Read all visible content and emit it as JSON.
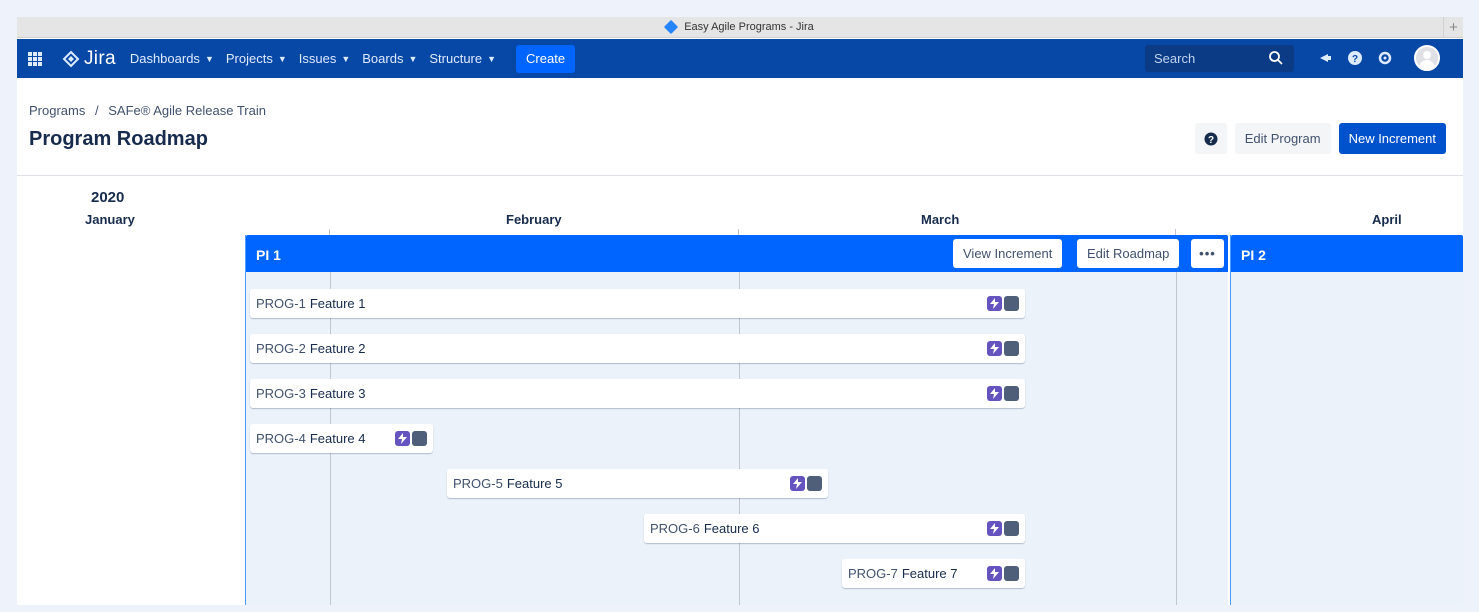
{
  "window": {
    "title": "Easy Agile Programs - Jira"
  },
  "nav": {
    "logo_text": "Jira",
    "menu": [
      {
        "label": "Dashboards"
      },
      {
        "label": "Projects"
      },
      {
        "label": "Issues"
      },
      {
        "label": "Boards"
      },
      {
        "label": "Structure"
      }
    ],
    "create_label": "Create",
    "search_placeholder": "Search",
    "icons": [
      "app-switcher-icon",
      "notifications-icon",
      "help-icon",
      "settings-icon",
      "avatar"
    ]
  },
  "breadcrumb": {
    "root": "Programs",
    "separator": "/",
    "current": "SAFe® Agile Release Train"
  },
  "page": {
    "title": "Program Roadmap",
    "actions": {
      "edit_program": "Edit Program",
      "new_increment": "New Increment"
    }
  },
  "timeline": {
    "year": "2020",
    "months": [
      "January",
      "February",
      "March",
      "April"
    ]
  },
  "increments": [
    {
      "label": "PI 1",
      "view_label": "View Increment",
      "edit_label": "Edit Roadmap",
      "more_label": "•••"
    },
    {
      "label": "PI 2"
    }
  ],
  "features": [
    {
      "key": "PROG-1",
      "name": "Feature 1"
    },
    {
      "key": "PROG-2",
      "name": "Feature 2"
    },
    {
      "key": "PROG-3",
      "name": "Feature 3"
    },
    {
      "key": "PROG-4",
      "name": "Feature 4"
    },
    {
      "key": "PROG-5",
      "name": "Feature 5"
    },
    {
      "key": "PROG-6",
      "name": "Feature 6"
    },
    {
      "key": "PROG-7",
      "name": "Feature 7"
    }
  ],
  "colors": {
    "nav": "#0747a6",
    "accent": "#0065ff",
    "increment_bg": "#ebf2fa",
    "epic_icon": "#6554c0",
    "team_icon": "#505f79"
  }
}
